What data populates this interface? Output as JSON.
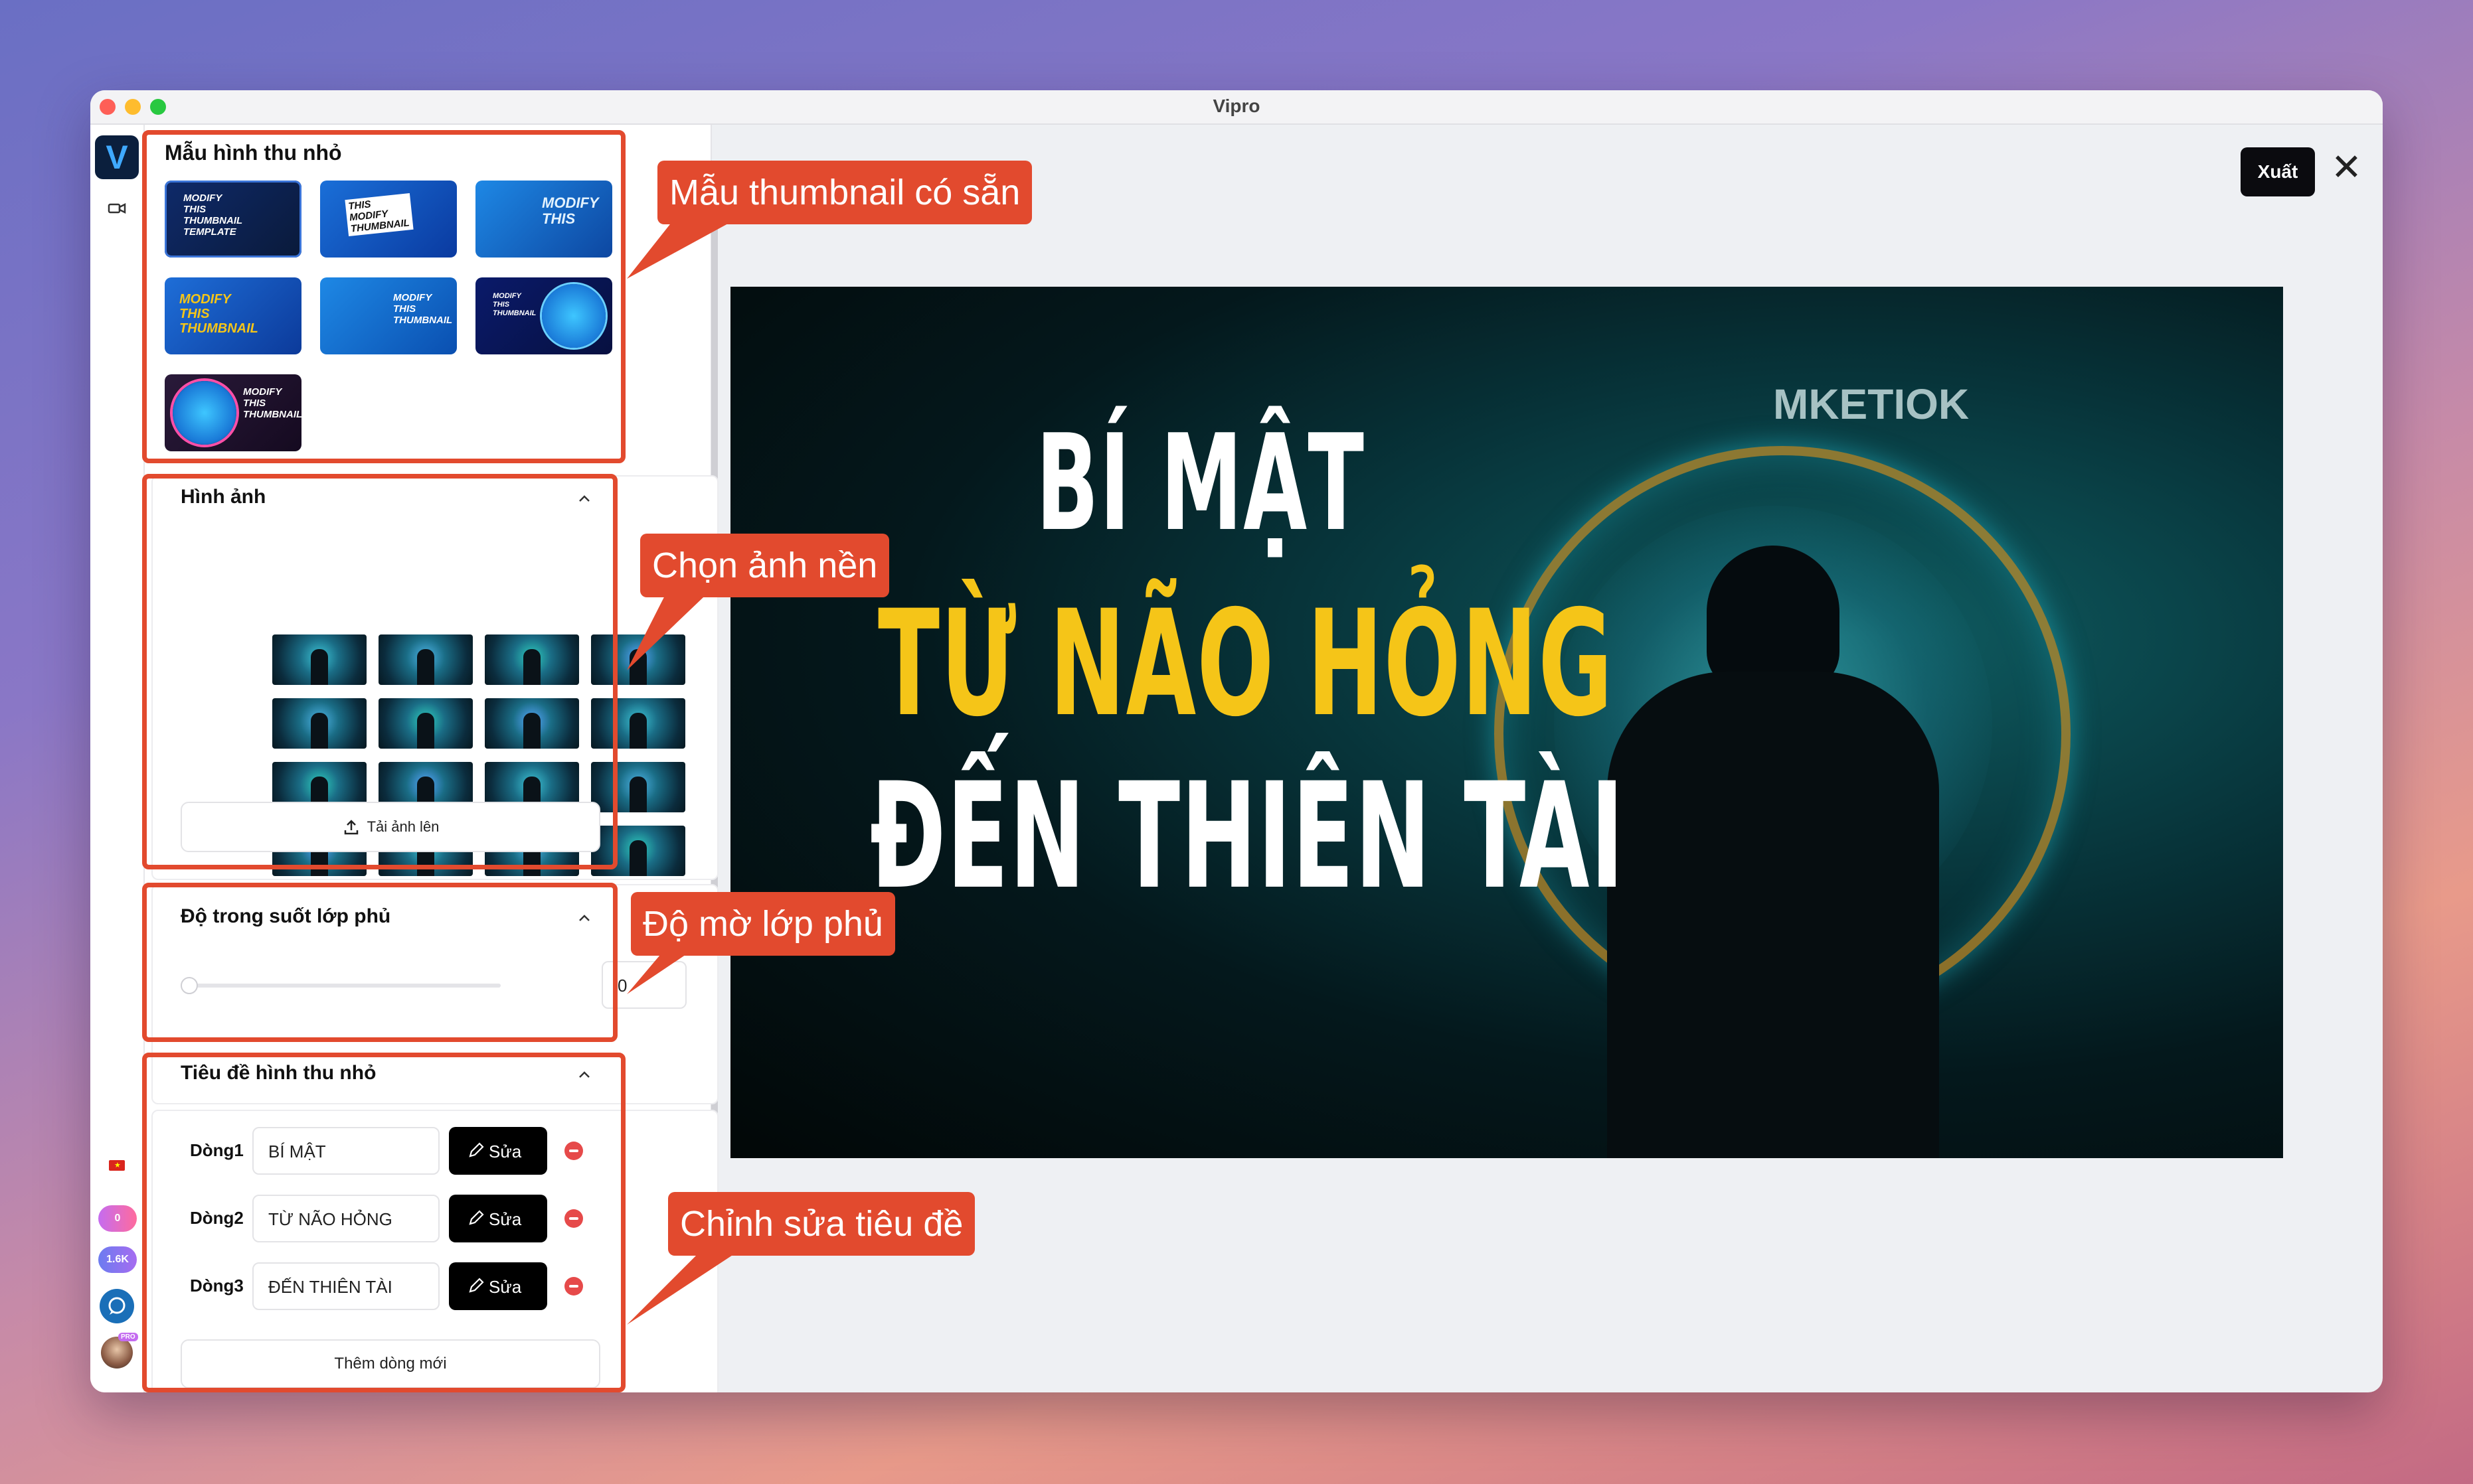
{
  "window": {
    "title": "Vipro"
  },
  "rail": {
    "badge_1": "0",
    "badge_2": "1.6K",
    "pro_badge": "PRO"
  },
  "templates": {
    "title": "Mẫu hình thu nhỏ",
    "items": [
      {
        "text": "MODIFY THIS THUMBNAIL TEMPLATE"
      },
      {
        "text": "THIS MODIFY THUMBNAIL"
      },
      {
        "text": "MODIFY THIS"
      },
      {
        "text": "MODIFY THIS THUMBNAIL"
      },
      {
        "text": "MODIFY THIS THUMBNAIL"
      },
      {
        "text": "MODIFY THIS THUMBNAIL"
      },
      {
        "text": "MODIFY THIS THUMBNAIL"
      }
    ]
  },
  "images": {
    "title": "Hình ảnh",
    "upload_label": "Tải ảnh lên"
  },
  "overlay": {
    "title": "Độ trong suốt lớp phủ",
    "value": "0"
  },
  "titles": {
    "title": "Tiêu đề hình thu nhỏ",
    "rows": [
      {
        "label": "Dòng1",
        "value": "BÍ MẬT",
        "edit_label": "Sửa"
      },
      {
        "label": "Dòng2",
        "value": "TỪ NÃO HỎNG",
        "edit_label": "Sửa"
      },
      {
        "label": "Dòng3",
        "value": "ĐẾN THIÊN TÀI",
        "edit_label": "Sửa"
      }
    ],
    "add_label": "Thêm dòng mới"
  },
  "callouts": {
    "templates": "Mẫu thumbnail có sẵn",
    "background": "Chọn ảnh nền",
    "overlay": "Độ mờ lớp phủ",
    "edit_title": "Chỉnh sửa tiêu đề"
  },
  "preview": {
    "line1": "BÍ MẬT",
    "line2": "TỪ NÃO HỎNG",
    "line3": "ĐẾN THIÊN TÀI",
    "bg_logo": "MKETIOK",
    "line1_color": "#ffffff",
    "line2_color": "#f5c518",
    "line3_color": "#ffffff"
  },
  "toolbar": {
    "export_label": "Xuất"
  },
  "colors": {
    "accent": "#e24a2e",
    "panel": "#ffffff",
    "button": "#000000"
  }
}
